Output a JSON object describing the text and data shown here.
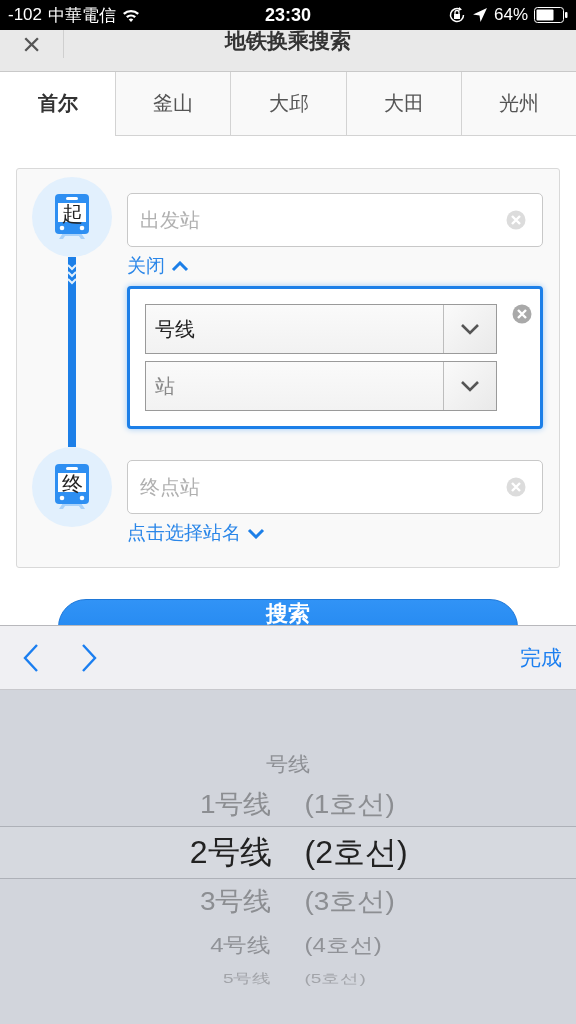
{
  "status_bar": {
    "signal": "-102",
    "carrier": "中華電信",
    "time": "23:30",
    "battery": "64%"
  },
  "nav": {
    "close": "×",
    "title": "地铁换乘搜索"
  },
  "tabs": [
    {
      "label": "首尔",
      "selected": true
    },
    {
      "label": "釜山",
      "selected": false
    },
    {
      "label": "大邱",
      "selected": false
    },
    {
      "label": "大田",
      "selected": false
    },
    {
      "label": "光州",
      "selected": false
    }
  ],
  "route": {
    "start": {
      "badge": "起",
      "placeholder": "出发站",
      "toggle": "关闭",
      "expanded": true
    },
    "line_select": {
      "value": "号线"
    },
    "station_select": {
      "placeholder": "站"
    },
    "end": {
      "badge": "终",
      "placeholder": "终点站",
      "toggle": "点击选择站名",
      "expanded": false
    }
  },
  "search_button": "搜索",
  "toolbar": {
    "done": "完成"
  },
  "picker": {
    "items": [
      {
        "label": "号线",
        "selected": false
      },
      {
        "label": "1号线",
        "korean": "(1호선)",
        "selected": false
      },
      {
        "label": "2号线",
        "korean": "(2호선)",
        "selected": true
      },
      {
        "label": "3号线",
        "korean": "(3호선)",
        "selected": false
      },
      {
        "label": "4号线",
        "korean": "(4호선)",
        "selected": false
      },
      {
        "label": "5号线",
        "korean": "(5호선)",
        "selected": false
      }
    ]
  }
}
